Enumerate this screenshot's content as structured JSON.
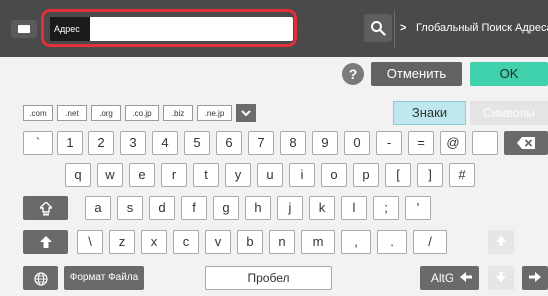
{
  "header": {
    "address_label": "Адрес",
    "address_value": "",
    "global_search_label": "Глобальный Поиск Адреса",
    "global_search_chevron": ">"
  },
  "actions": {
    "help_label": "?",
    "cancel_label": "Отменить",
    "ok_label": "OK"
  },
  "domains": [
    ".com",
    ".net",
    ".org",
    ".co.jp",
    ".biz",
    ".ne.jp"
  ],
  "modes": {
    "letters_label": "Знаки",
    "symbols_label": "Символы"
  },
  "keys": {
    "row1": [
      "`",
      "1",
      "2",
      "3",
      "4",
      "5",
      "6",
      "7",
      "8",
      "9",
      "0",
      "-",
      "=",
      "@"
    ],
    "row2": [
      "q",
      "w",
      "e",
      "r",
      "t",
      "y",
      "u",
      "i",
      "o",
      "p",
      "[",
      "]",
      "#"
    ],
    "row3": [
      "a",
      "s",
      "d",
      "f",
      "g",
      "h",
      "j",
      "k",
      "l",
      ";",
      "'"
    ],
    "row4": [
      "\\",
      "z",
      "x",
      "c",
      "v",
      "b",
      "n",
      "m",
      ",",
      ".",
      "/"
    ]
  },
  "bottom": {
    "format_label": "Формат Файла",
    "space_label": "Пробел",
    "altgr_label": "AltGr"
  },
  "colors": {
    "accent": "#3fd0ac",
    "highlight": "#e0303a",
    "mode_active": "#bfe8ee"
  }
}
